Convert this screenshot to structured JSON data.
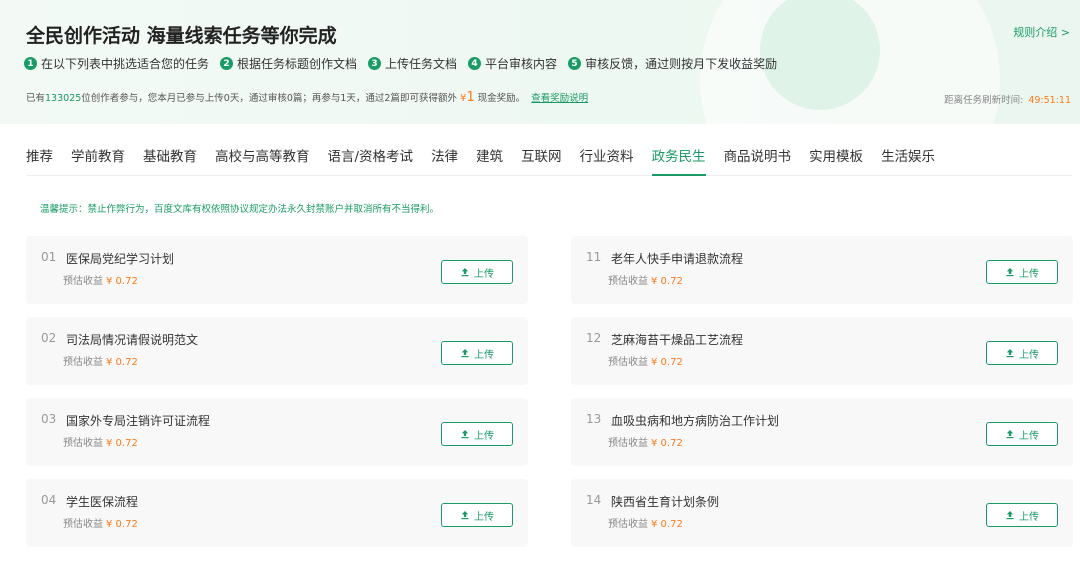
{
  "banner": {
    "title": "全民创作活动 海量线索任务等你完成",
    "rules_link": "规则介绍 >",
    "steps": [
      {
        "num": "1",
        "text": "在以下列表中挑选适合您的任务"
      },
      {
        "num": "2",
        "text": "根据任务标题创作文档"
      },
      {
        "num": "3",
        "text": "上传任务文档"
      },
      {
        "num": "4",
        "text": "平台审核内容"
      },
      {
        "num": "5",
        "text": "审核反馈，通过则按月下发收益奖励"
      }
    ],
    "stats": {
      "prefix": "已有",
      "creators": "133025",
      "middle": "位创作者参与，您本月已参与上传0天，通过审核0篇；再参与1天，通过2篇即可获得额外",
      "currency": "¥",
      "bonus": "1",
      "suffix": "现金奖励。",
      "link": "查看奖励说明"
    },
    "refresh_label": "距离任务刷新时间:",
    "refresh_timer": "49:51:11"
  },
  "tabs": [
    "推荐",
    "学前教育",
    "基础教育",
    "高校与高等教育",
    "语言/资格考试",
    "法律",
    "建筑",
    "互联网",
    "行业资料",
    "政务民生",
    "商品说明书",
    "实用模板",
    "生活娱乐"
  ],
  "active_tab": "政务民生",
  "notice": "温馨提示：禁止作弊行为，百度文库有权依照协议规定办法永久封禁账户并取消所有不当得利。",
  "earn_label": "预估收益",
  "upload_label": "上传",
  "tasks_left": [
    {
      "num": "01",
      "title": "医保局党纪学习计划",
      "earn": "¥ 0.72"
    },
    {
      "num": "02",
      "title": "司法局情况请假说明范文",
      "earn": "¥ 0.72"
    },
    {
      "num": "03",
      "title": "国家外专局注销许可证流程",
      "earn": "¥ 0.72"
    },
    {
      "num": "04",
      "title": "学生医保流程",
      "earn": "¥ 0.72"
    }
  ],
  "tasks_right": [
    {
      "num": "11",
      "title": "老年人快手申请退款流程",
      "earn": "¥ 0.72"
    },
    {
      "num": "12",
      "title": "芝麻海苔干燥品工艺流程",
      "earn": "¥ 0.72"
    },
    {
      "num": "13",
      "title": "血吸虫病和地方病防治工作计划",
      "earn": "¥ 0.72"
    },
    {
      "num": "14",
      "title": "陕西省生育计划条例",
      "earn": "¥ 0.72"
    }
  ],
  "colors": {
    "accent": "#1a9b66",
    "price": "#ff7a1a"
  }
}
